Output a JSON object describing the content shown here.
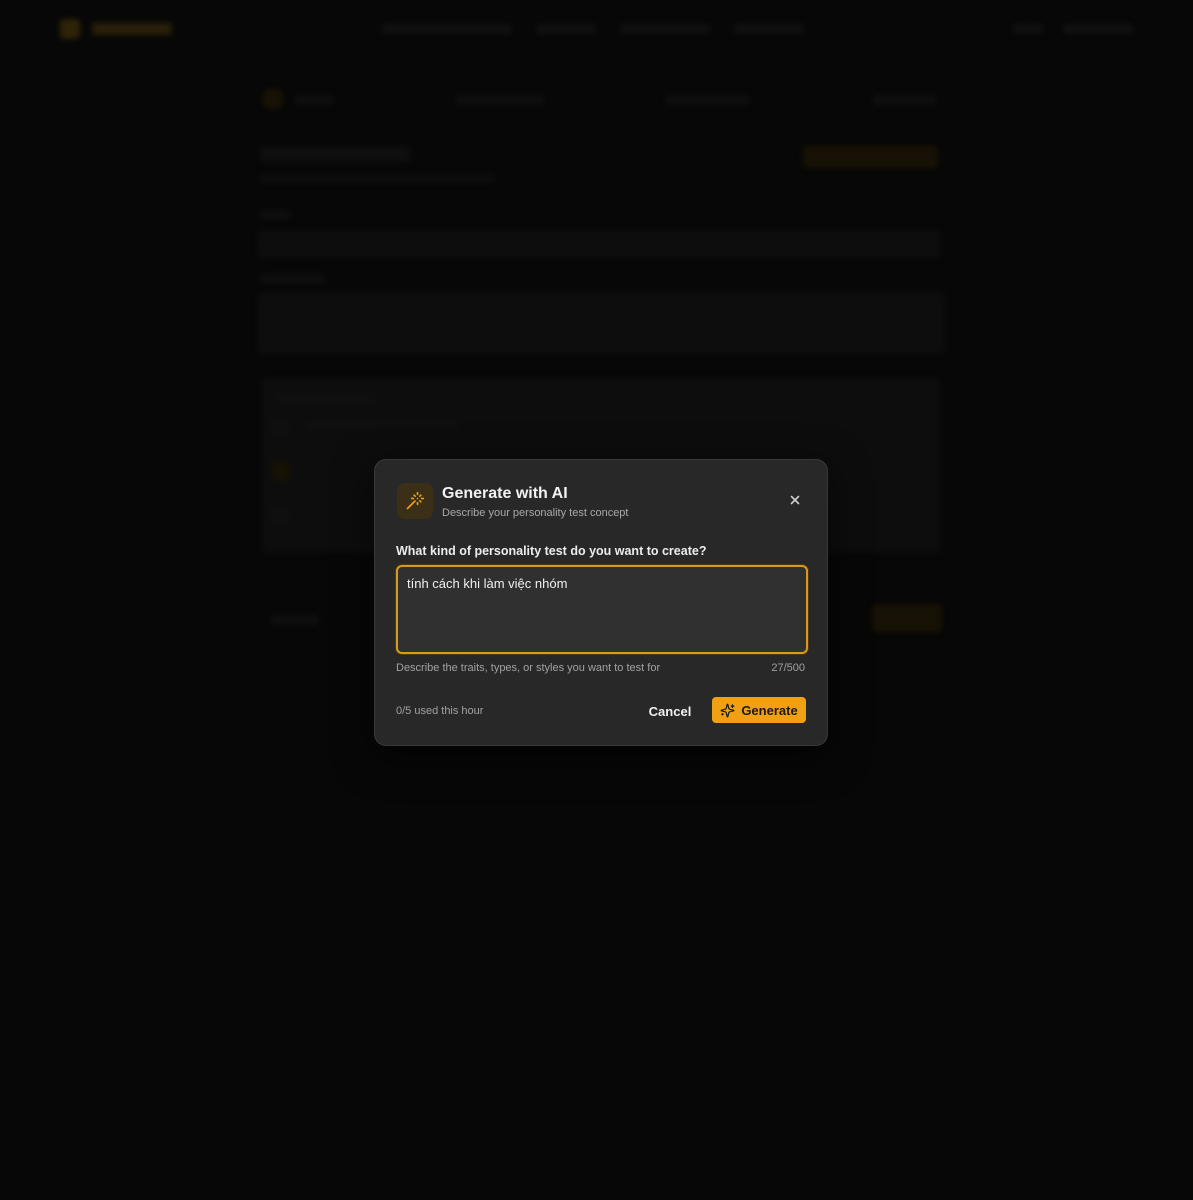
{
  "modal": {
    "title": "Generate with AI",
    "subtitle": "Describe your personality test concept",
    "icon": "magic-wand-icon",
    "close_icon": "close-icon",
    "field_label": "What kind of personality test do you want to create?",
    "prompt_value": "tính cách khi làm việc nhóm",
    "hint": "Describe the traits, types, or styles you want to test for",
    "char_count": "27/500",
    "usage": "0/5 used this hour",
    "cancel_label": "Cancel",
    "generate_label": "Generate",
    "generate_icon": "sparkles-icon"
  },
  "colors": {
    "accent": "#f0a012",
    "modal_bg": "#282828",
    "page_bg": "#0b0b0b"
  }
}
